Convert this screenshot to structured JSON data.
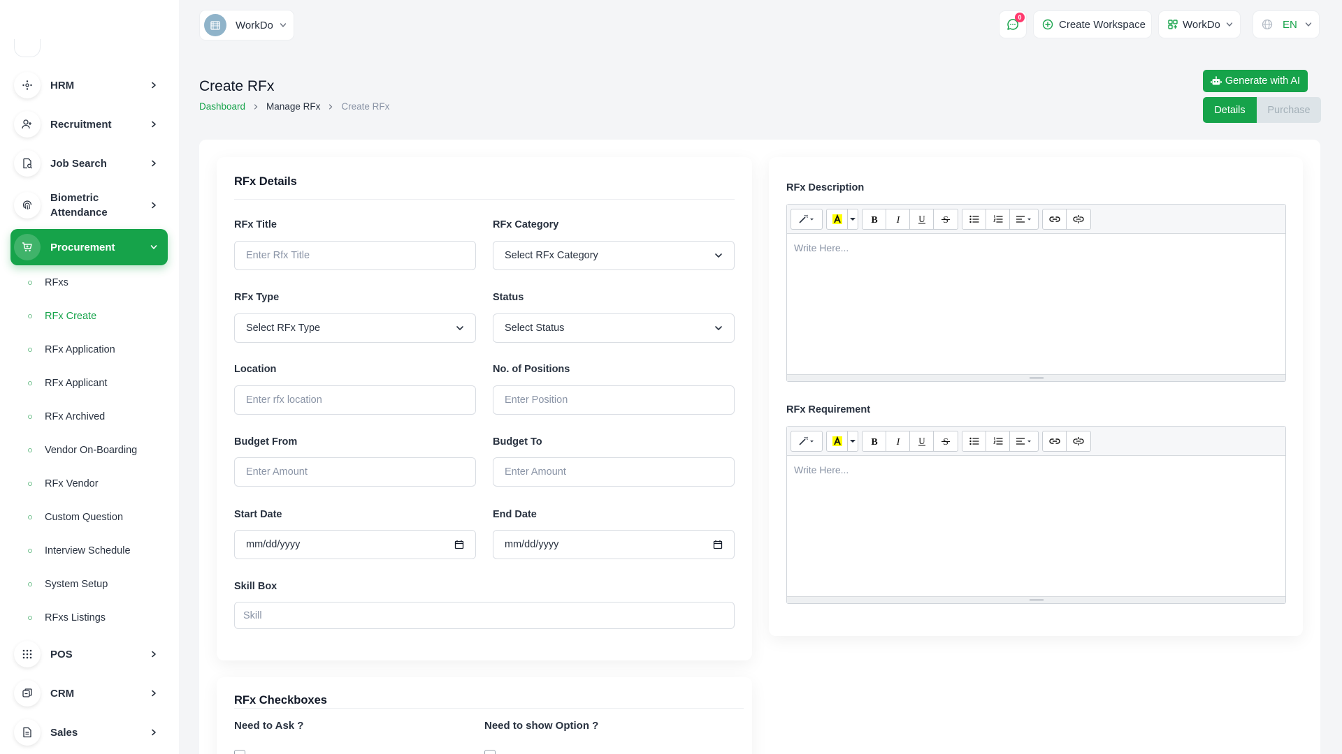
{
  "sidebar": {
    "menu": [
      {
        "label": "HRM",
        "icon": "hrm-icon"
      },
      {
        "label": "Recruitment",
        "icon": "user-plus-icon"
      },
      {
        "label": "Job Search",
        "icon": "job-search-icon"
      },
      {
        "label": "Biometric Attendance",
        "icon": "fingerprint-icon"
      },
      {
        "label": "Procurement",
        "icon": "cart-icon",
        "active": true
      },
      {
        "label": "POS",
        "icon": "grid-dots-icon"
      },
      {
        "label": "CRM",
        "icon": "crm-icon"
      },
      {
        "label": "Sales",
        "icon": "file-icon"
      }
    ],
    "submenu": [
      "RFxs",
      "RFx Create",
      "RFx Application",
      "RFx Applicant",
      "RFx Archived",
      "Vendor On-Boarding",
      "RFx Vendor",
      "Custom Question",
      "Interview Schedule",
      "System Setup",
      "RFxs Listings"
    ],
    "active_sub": "RFx Create"
  },
  "header": {
    "workspace": "WorkDo",
    "message_count": "0",
    "create_workspace": "Create Workspace",
    "company": "WorkDo",
    "language": "EN"
  },
  "page": {
    "title": "Create RFx",
    "breadcrumb": [
      "Dashboard",
      "Manage RFx",
      "Create RFx"
    ],
    "generate_ai": "Generate with AI",
    "tabs": [
      "Details",
      "Purchase"
    ]
  },
  "details": {
    "title": "RFx Details",
    "fields": {
      "rfx_title": {
        "label": "RFx Title",
        "placeholder": "Enter Rfx Title"
      },
      "rfx_category": {
        "label": "RFx Category",
        "value": "Select RFx Category"
      },
      "rfx_type": {
        "label": "RFx Type",
        "value": "Select RFx Type"
      },
      "status": {
        "label": "Status",
        "value": "Select Status"
      },
      "location": {
        "label": "Location",
        "placeholder": "Enter rfx location"
      },
      "positions": {
        "label": "No. of Positions",
        "placeholder": "Enter Position"
      },
      "budget_from": {
        "label": "Budget From",
        "placeholder": "Enter Amount"
      },
      "budget_to": {
        "label": "Budget To",
        "placeholder": "Enter Amount"
      },
      "start_date": {
        "label": "Start Date",
        "value": "mm/dd/yyyy"
      },
      "end_date": {
        "label": "End Date",
        "value": "mm/dd/yyyy"
      },
      "skill_box": {
        "label": "Skill Box",
        "placeholder": "Skill"
      }
    }
  },
  "editors": {
    "description": {
      "label": "RFx Description",
      "placeholder": "Write Here..."
    },
    "requirement": {
      "label": "RFx Requirement",
      "placeholder": "Write Here..."
    }
  },
  "checkboxes": {
    "title": "RFx Checkboxes",
    "ask_label": "Need to Ask ?",
    "show_label": "Need to show Option ?"
  },
  "colors": {
    "accent": "#16a34a",
    "badge": "#ff3a6e"
  }
}
